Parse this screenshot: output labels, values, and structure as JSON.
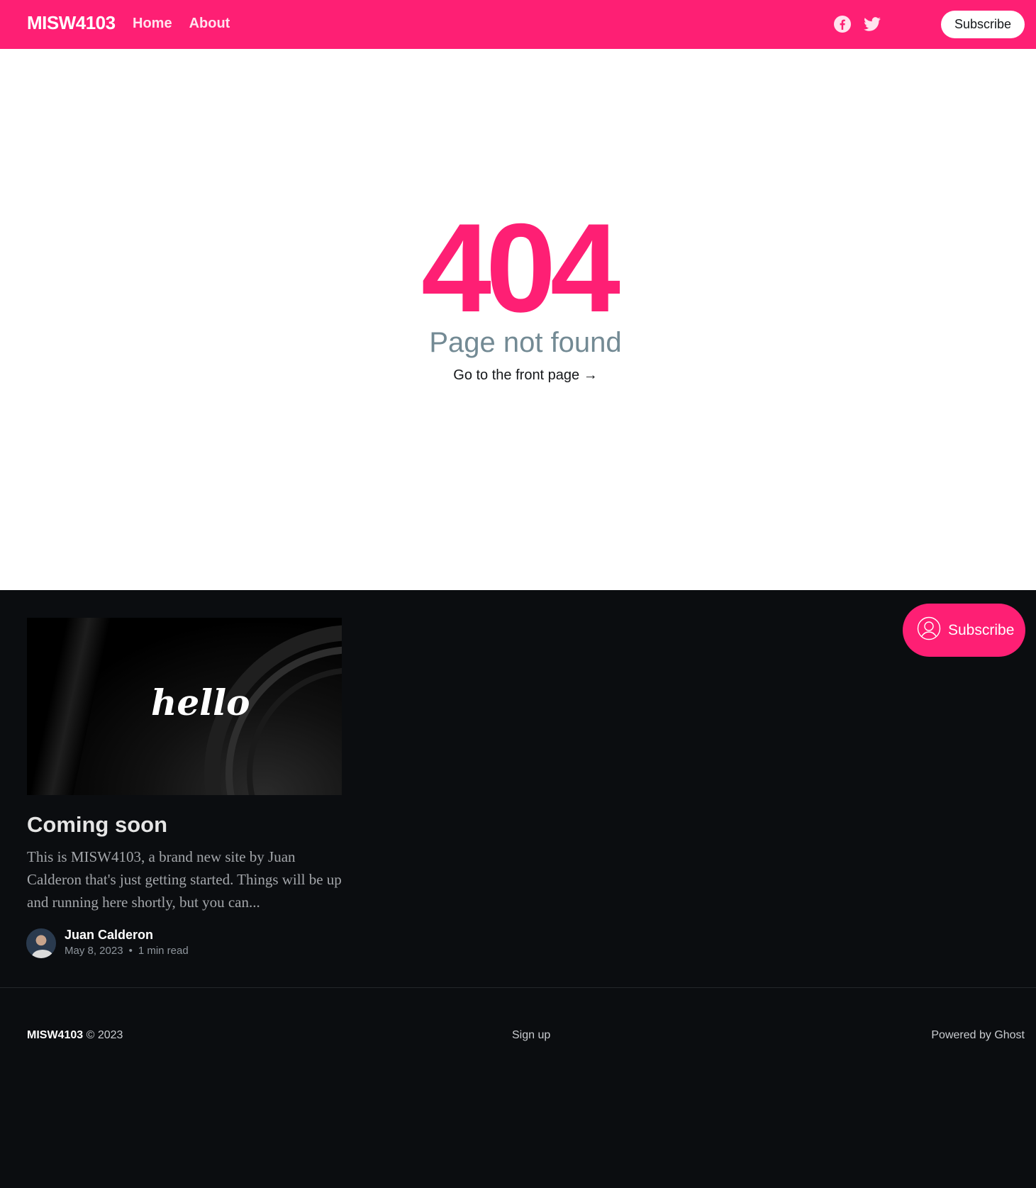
{
  "header": {
    "site_title": "MISW4103",
    "nav": [
      {
        "label": "Home"
      },
      {
        "label": "About"
      }
    ],
    "social": [
      "facebook-icon",
      "twitter-icon"
    ],
    "subscribe_label": "Subscribe",
    "accent_color": "#fe1f74"
  },
  "error": {
    "code": "404",
    "description": "Page not found",
    "link_label": "Go to the front page →"
  },
  "post": {
    "image_text": "hello",
    "title": "Coming soon",
    "excerpt": "This is MISW4103, a brand new site by Juan Calderon that's just getting started. Things will be up and running here shortly, but you can...",
    "author": "Juan Calderon",
    "date": "May 8, 2023",
    "separator": "•",
    "reading_time": "1 min read"
  },
  "floating_subscribe": {
    "label": "Subscribe"
  },
  "footer": {
    "site_title": "MISW4103",
    "copyright": "© 2023",
    "signup": "Sign up",
    "powered": "Powered by Ghost"
  }
}
